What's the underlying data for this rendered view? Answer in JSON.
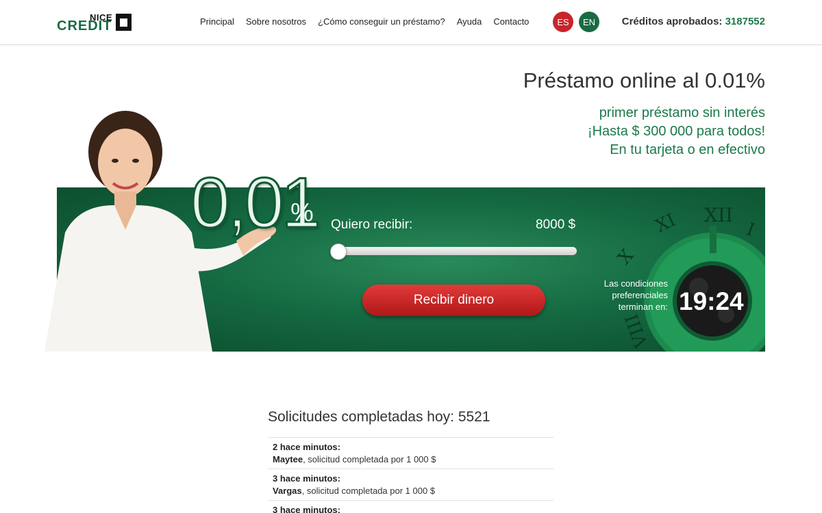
{
  "header": {
    "logo": {
      "top": "NICE",
      "main": "CREDIT"
    },
    "nav": [
      "Principal",
      "Sobre nosotros",
      "¿Cómo conseguir un préstamo?",
      "Ayuda",
      "Contacto"
    ],
    "languages": [
      "ES",
      "EN"
    ],
    "approved_label": "Créditos aprobados:",
    "approved_count": "3187552"
  },
  "hero": {
    "title": "Préstamo online al 0.01%",
    "subtitle_lines": [
      "primer préstamo sin interés",
      "¡Hasta $ 300 000 para todos!",
      "En tu tarjeta o en efectivo"
    ],
    "big_rate": "0,01",
    "big_pct": "%",
    "slider_label": "Quiero recibir:",
    "amount": "8000 $",
    "amount_fraction": 0.02,
    "cta": "Recibir dinero",
    "conditions_text": "Las condiciones preferenciales terminan en:",
    "timer": "19:24",
    "colors": {
      "brand_green": "#1a7a4a",
      "cta_red": "#c8252b",
      "banner_green": "#156a42"
    }
  },
  "requests": {
    "title": "Solicitudes completadas hoy: 5521",
    "items": [
      {
        "when": "2 hace minutos:",
        "name": "Maytee",
        "text": ", solicitud completada por 1 000 $"
      },
      {
        "when": "3 hace minutos:",
        "name": "Vargas",
        "text": ", solicitud completada por 1 000 $"
      },
      {
        "when": "3 hace minutos:",
        "name": "",
        "text": ""
      }
    ]
  }
}
